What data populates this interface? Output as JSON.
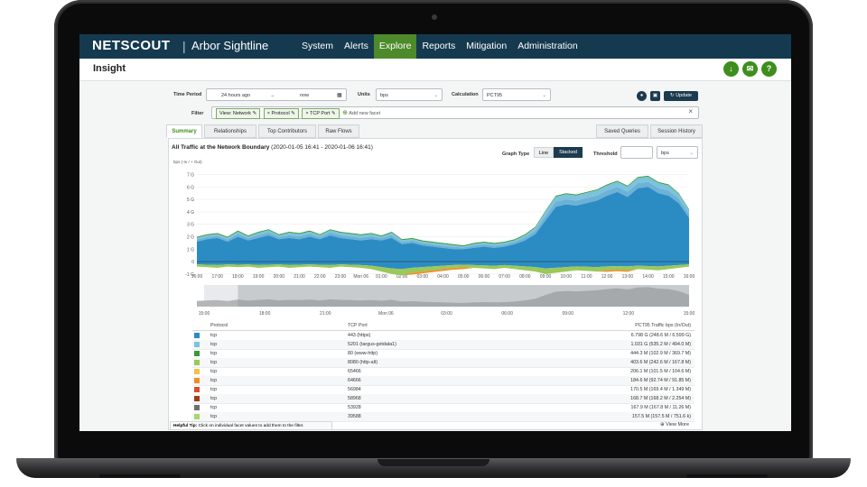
{
  "app": {
    "brand": "NETSCOUT",
    "product": "Arbor Sightline"
  },
  "nav": [
    "System",
    "Alerts",
    "Explore",
    "Reports",
    "Mitigation",
    "Administration"
  ],
  "nav_active": "Explore",
  "page": {
    "title": "Insight"
  },
  "header_icons": [
    "download-icon",
    "email-icon",
    "help-icon"
  ],
  "filters": {
    "time_period_label": "Time Period",
    "time_from": "24 hours ago",
    "time_arrow": "→",
    "time_to": "now",
    "units_label": "Units",
    "units_value": "bps",
    "calculation_label": "Calculation",
    "calculation_value": "PCT95",
    "update_label": "Update",
    "filter_label": "Filter",
    "chips": [
      "View: Network",
      "Protocol",
      "TCP Port"
    ],
    "add_facet": "Add new facet",
    "clear": "×"
  },
  "tabs": [
    "Summary",
    "Relationships",
    "Top Contributors",
    "Raw Flows"
  ],
  "right_tabs": [
    "Saved Queries",
    "Session History"
  ],
  "chart_header": {
    "title": "All Traffic at the Network Boundary",
    "range": "(2020-01-05 16:41 - 2020-01-06 16:41)",
    "graph_type_label": "Graph Type",
    "graph_type_options": [
      "Line",
      "Stacked"
    ],
    "graph_type_selected": "Stacked",
    "threshold_label": "Threshold",
    "threshold_value": "",
    "threshold_units": "bps"
  },
  "chart_data": {
    "type": "area",
    "ylabel": "bps (-In / + Out)",
    "y_ticks": [
      "7 G",
      "6 G",
      "5 G",
      "4 G",
      "3 G",
      "2 G",
      "1 G",
      "0",
      "-1 G"
    ],
    "ylim": [
      -1.3,
      7.4
    ],
    "x_ticks": [
      "16:00",
      "17:00",
      "18:00",
      "19:00",
      "20:00",
      "21:00",
      "22:00",
      "23:00",
      "Mon 06",
      "01:00",
      "02:00",
      "03:00",
      "04:00",
      "05:00",
      "06:00",
      "07:00",
      "08:00",
      "09:00",
      "10:00",
      "11:00",
      "12:00",
      "13:00",
      "14:00",
      "15:00",
      "16:00"
    ],
    "overview_ticks": [
      "15:00",
      "18:00",
      "21:00",
      "Mon 06",
      "03:00",
      "06:00",
      "09:00",
      "12:00",
      "15:00"
    ],
    "x_hours": [
      0,
      0.5,
      1,
      1.5,
      2,
      2.5,
      3,
      3.5,
      4,
      4.5,
      5,
      5.5,
      6,
      6.5,
      7,
      7.5,
      8,
      8.5,
      9,
      9.5,
      10,
      10.5,
      11,
      11.5,
      12,
      12.5,
      13,
      13.5,
      14,
      14.5,
      15,
      15.5,
      16,
      16.5,
      17,
      17.5,
      18,
      18.5,
      19,
      19.5,
      20,
      20.5,
      21,
      21.5,
      22,
      22.5,
      23,
      23.5,
      24
    ],
    "out_total": [
      2.0,
      2.2,
      2.3,
      2.0,
      2.5,
      2.1,
      2.4,
      2.6,
      2.2,
      2.4,
      2.3,
      2.5,
      2.2,
      2.6,
      2.4,
      2.3,
      2.2,
      2.3,
      2.1,
      2.4,
      1.8,
      1.9,
      1.7,
      1.6,
      1.5,
      1.4,
      1.3,
      1.5,
      1.6,
      1.5,
      1.6,
      1.8,
      2.2,
      2.8,
      4.1,
      5.3,
      5.5,
      5.4,
      5.6,
      5.8,
      6.2,
      6.5,
      6.1,
      6.8,
      6.9,
      6.4,
      6.2,
      5.5,
      4.2
    ],
    "out_main": [
      1.6,
      1.8,
      1.9,
      1.6,
      2.0,
      1.7,
      1.9,
      2.1,
      1.8,
      1.9,
      1.8,
      2.0,
      1.8,
      2.1,
      1.9,
      1.8,
      1.7,
      1.8,
      1.7,
      1.9,
      1.4,
      1.5,
      1.3,
      1.2,
      1.1,
      1.0,
      1.0,
      1.1,
      1.2,
      1.1,
      1.2,
      1.4,
      1.7,
      2.2,
      3.3,
      4.4,
      4.6,
      4.5,
      4.7,
      4.9,
      5.3,
      5.6,
      5.2,
      5.9,
      6.0,
      5.5,
      5.3,
      4.7,
      3.5
    ],
    "in_total": [
      -0.4,
      -0.45,
      -0.5,
      -0.4,
      -0.45,
      -0.4,
      -0.5,
      -0.45,
      -0.4,
      -0.5,
      -0.45,
      -0.4,
      -0.45,
      -0.5,
      -0.4,
      -0.45,
      -0.5,
      -0.6,
      -0.8,
      -1.0,
      -1.1,
      -0.9,
      -0.8,
      -0.7,
      -0.6,
      -0.5,
      -0.45,
      -0.5,
      -0.55,
      -0.6,
      -0.5,
      -0.6,
      -0.7,
      -0.8,
      -1.0,
      -0.9,
      -0.8,
      -0.7,
      -0.75,
      -0.8,
      -0.7,
      -0.65,
      -0.7,
      -0.6,
      -0.65,
      -0.7,
      -0.6,
      -0.5,
      -0.4
    ],
    "series_colors": [
      "#2b8cc4",
      "#7cc3dd",
      "#3a9a3a",
      "#9ac85a",
      "#f2c04b",
      "#ef8f2c",
      "#d9502a",
      "#9e3d1c",
      "#6f6f6f",
      "#c0c0c0",
      "#a8d86e"
    ],
    "table": {
      "headers": [
        "Protocol",
        "TCP Port",
        "PCT95 Traffic bps (In/Out)"
      ],
      "rows": [
        {
          "color": "#2b8cc4",
          "protocol": "tcp",
          "port": "443 (https)",
          "value": "6.798 G (248.6 M / 6.599 G)"
        },
        {
          "color": "#7cc3dd",
          "protocol": "tcp",
          "port": "5201 (targus-getdata1)",
          "value": "1.031 G (535.2 M / 494.0 M)"
        },
        {
          "color": "#3a9a3a",
          "protocol": "tcp",
          "port": "80 (www-http)",
          "value": "444.3 M (102.9 M / 369.7 M)"
        },
        {
          "color": "#9ac85a",
          "protocol": "tcp",
          "port": "8080 (http-alt)",
          "value": "403.6 M (242.6 M / 167.8 M)"
        },
        {
          "color": "#f2c04b",
          "protocol": "tcp",
          "port": "65466",
          "value": "206.1 M (101.5 M / 104.6 M)"
        },
        {
          "color": "#ef8f2c",
          "protocol": "tcp",
          "port": "64666",
          "value": "184.6 M (92.74 M / 91.85 M)"
        },
        {
          "color": "#d9502a",
          "protocol": "tcp",
          "port": "56984",
          "value": "170.5 M (169.4 M / 1.349 M)"
        },
        {
          "color": "#9e3d1c",
          "protocol": "tcp",
          "port": "58968",
          "value": "168.7 M (168.2 M / 2.254 M)"
        },
        {
          "color": "#6f6f6f",
          "protocol": "tcp",
          "port": "53928",
          "value": "167.9 M (167.8 M / 11.26 M)"
        },
        {
          "color": "#a8d86e",
          "protocol": "tcp",
          "port": "39588",
          "value": "157.5 M (157.5 M / 751.6 k)"
        }
      ]
    }
  },
  "footer": {
    "tip_label": "Helpful Tip:",
    "tip_text": "Click on individual facet values to add them to the filter.",
    "view_more": "View More"
  }
}
